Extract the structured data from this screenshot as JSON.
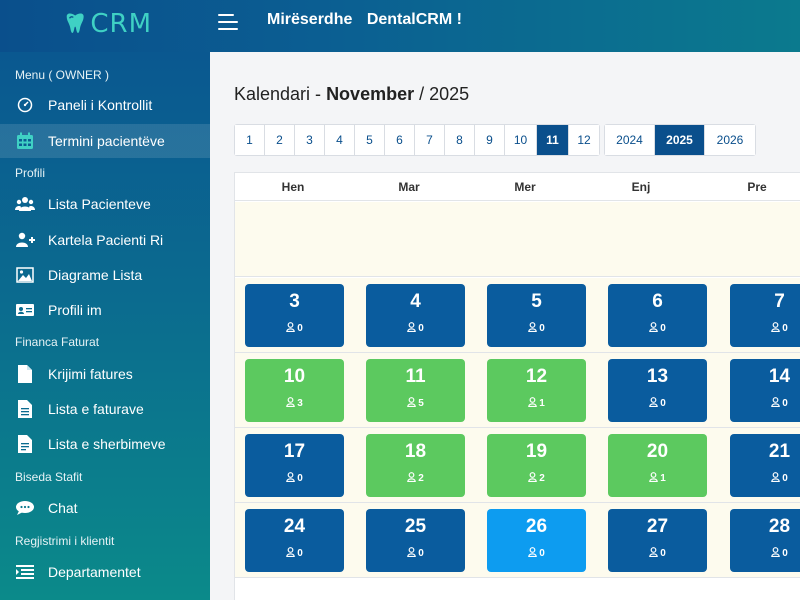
{
  "app": {
    "logo_text": "CRM",
    "welcome_prefix": "Mirëserdhe",
    "welcome_name": "DentalCRM !"
  },
  "sidebar": {
    "sections": [
      {
        "title": "Menu ( OWNER )"
      },
      {
        "title": "Profili"
      },
      {
        "title": "Financa Faturat"
      },
      {
        "title": "Biseda Stafit"
      },
      {
        "title": "Regjistrimi i klientit"
      }
    ],
    "items": [
      {
        "label": "Paneli i Kontrollit",
        "icon": "dashboard-icon"
      },
      {
        "label": "Termini pacientëve",
        "icon": "calendar-icon",
        "active": true
      },
      {
        "label": "Lista Pacienteve",
        "icon": "users-icon"
      },
      {
        "label": "Kartela Pacienti Ri",
        "icon": "user-plus-icon"
      },
      {
        "label": "Diagrame Lista",
        "icon": "image-icon"
      },
      {
        "label": "Profili im",
        "icon": "id-card-icon"
      },
      {
        "label": "Krijimi fatures",
        "icon": "file-icon"
      },
      {
        "label": "Lista e faturave",
        "icon": "file-text-icon"
      },
      {
        "label": "Lista e sherbimeve",
        "icon": "file-list-icon"
      },
      {
        "label": "Chat",
        "icon": "chat-icon"
      },
      {
        "label": "Departamentet",
        "icon": "list-icon"
      }
    ]
  },
  "calendar": {
    "title_prefix": "Kalendari -",
    "month": "November",
    "year_sep": "/",
    "year": "2025",
    "months": [
      "1",
      "2",
      "3",
      "4",
      "5",
      "6",
      "7",
      "8",
      "9",
      "10",
      "11",
      "12"
    ],
    "active_month": "11",
    "years": [
      "2024",
      "2025",
      "2026"
    ],
    "active_year": "2025",
    "weekdays": [
      "Hen",
      "Mar",
      "Mer",
      "Enj",
      "Pre"
    ],
    "weeks": [
      [
        {
          "day": "3",
          "count": "0",
          "status": "blue"
        },
        {
          "day": "4",
          "count": "0",
          "status": "blue"
        },
        {
          "day": "5",
          "count": "0",
          "status": "blue"
        },
        {
          "day": "6",
          "count": "0",
          "status": "blue"
        },
        {
          "day": "7",
          "count": "0",
          "status": "blue"
        }
      ],
      [
        {
          "day": "10",
          "count": "3",
          "status": "green"
        },
        {
          "day": "11",
          "count": "5",
          "status": "green"
        },
        {
          "day": "12",
          "count": "1",
          "status": "green"
        },
        {
          "day": "13",
          "count": "0",
          "status": "blue"
        },
        {
          "day": "14",
          "count": "0",
          "status": "blue"
        }
      ],
      [
        {
          "day": "17",
          "count": "0",
          "status": "blue"
        },
        {
          "day": "18",
          "count": "2",
          "status": "green"
        },
        {
          "day": "19",
          "count": "2",
          "status": "green"
        },
        {
          "day": "20",
          "count": "1",
          "status": "green"
        },
        {
          "day": "21",
          "count": "0",
          "status": "blue"
        }
      ],
      [
        {
          "day": "24",
          "count": "0",
          "status": "blue"
        },
        {
          "day": "25",
          "count": "0",
          "status": "blue"
        },
        {
          "day": "26",
          "count": "0",
          "status": "today"
        },
        {
          "day": "27",
          "count": "0",
          "status": "blue"
        },
        {
          "day": "28",
          "count": "0",
          "status": "blue"
        }
      ]
    ]
  },
  "colors": {
    "primary": "#0a4f8c",
    "accent_logo": "#3fd1c4",
    "green": "#5cc95f",
    "blue": "#0a5c9e",
    "today": "#0d9cf0",
    "week_bg": "#fdfbee"
  }
}
